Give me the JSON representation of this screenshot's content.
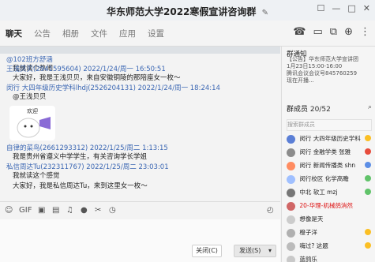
{
  "window": {
    "title": "华东师范大学2022寒假宣讲咨询群",
    "title_edit_icon": "edit-icon"
  },
  "window_controls": [
    "☐",
    "—",
    "□",
    "✕"
  ],
  "tabs": [
    "聊天",
    "公告",
    "相册",
    "文件",
    "应用",
    "设置"
  ],
  "toolbar_icons": [
    "phone-icon",
    "video-icon",
    "screen-share-icon",
    "add-member-icon",
    "more-icon"
  ],
  "chat": {
    "messages": [
      {
        "type": "text",
        "name": "@102班方舒涵",
        "body": "我就读个热闹"
      },
      {
        "type": "text",
        "name": "王浅贝贝(2941595604) 2022/1/24/周一 16:50:51",
        "body": "大家好，我是王浅贝贝，来自安徽铜陵的那陪座女一枚～"
      },
      {
        "type": "text",
        "name": "闵行 大四年级历史学科lhdj(2526204131) 2022/1/24/周一 18:24:14",
        "body": "@王浅贝贝"
      },
      {
        "type": "sticker",
        "name": "",
        "body": "欢迎"
      },
      {
        "type": "text",
        "name": "自律的菜鸟(2661293312) 2022/1/25/周二 1:13:15",
        "body": "我是贵州省遵义中学学生，有关咨询学长学姐"
      },
      {
        "type": "text",
        "name": "私信周达Tu(232311767) 2022/1/25/周二 23:03:01",
        "body": "我就读这个感觉"
      },
      {
        "type": "text",
        "name": "",
        "body": "大家好，我是私信周达Tu，来到这里女一枚～"
      }
    ]
  },
  "input_bar": {
    "icons": [
      "emoji-icon",
      "gif-icon",
      "image-icon",
      "file-icon",
      "music-icon",
      "mic-icon",
      "cut-icon",
      "clock-icon",
      "history-icon"
    ],
    "close_label": "关闭(C)",
    "send_label": "发送(S)"
  },
  "notice": {
    "title": "群通知",
    "body": "【公告】华东师范大学宣讲团\n1月23日15:00-16:00\n腾讯会议会议号845760259\n现在开播..."
  },
  "members": {
    "title": "群成员",
    "count": "20/52",
    "search_placeholder": "搜索群成员",
    "list": [
      {
        "name": "闵行 大四年级历史学科",
        "color": "#5b7fd6",
        "badge": "#fbbf24"
      },
      {
        "name": "闵行 金融学类 张雅",
        "color": "#8c8c8c",
        "badge": "#e74c3c"
      },
      {
        "name": "闵行 新闻传播类 shn",
        "color": "#ff8c61",
        "badge": "#5d8fe6"
      },
      {
        "name": "闵行校区 化学高瞻",
        "color": "#a0c0ff",
        "badge": "#61c36a"
      },
      {
        "name": "中北 软工 mzj",
        "color": "#777777",
        "badge": "#61c36a"
      },
      {
        "name": "20-华理-机械鸽消然",
        "color": "#d06666",
        "text_color": "#d11",
        "badge": ""
      },
      {
        "name": "想像是天",
        "color": "#cccccc",
        "badge": ""
      },
      {
        "name": "橙子洋",
        "color": "#b0b0b0",
        "badge": "#fbbf24"
      },
      {
        "name": "嗨过? 这题",
        "color": "#bbbbbb",
        "badge": "#fbbf24"
      },
      {
        "name": "蓝鸽乐",
        "color": "#c9c9c9",
        "badge": ""
      }
    ]
  }
}
